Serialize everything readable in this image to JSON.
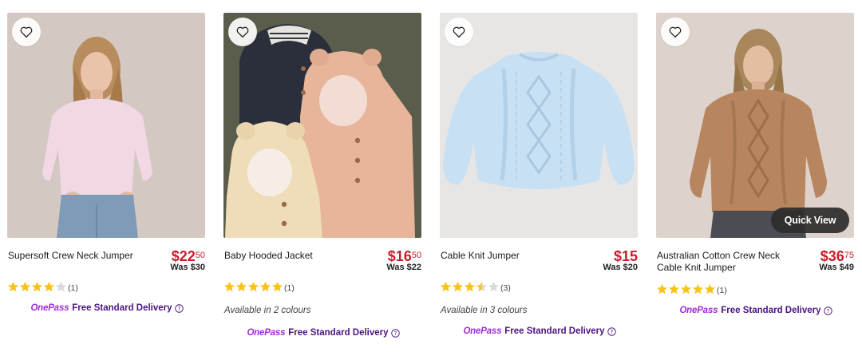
{
  "products": [
    {
      "title": "Supersoft Crew Neck Jumper",
      "price_dollars": "$22",
      "price_cents": "50",
      "was": "Was $30",
      "rating": 4,
      "review_count": "(1)",
      "colours": "",
      "onepass": "OnePass",
      "delivery": "Free Standard Delivery",
      "quick_view": ""
    },
    {
      "title": "Baby Hooded Jacket",
      "price_dollars": "$16",
      "price_cents": "50",
      "was": "Was $22",
      "rating": 5,
      "review_count": "(1)",
      "colours": "Available in 2 colours",
      "onepass": "OnePass",
      "delivery": "Free Standard Delivery",
      "quick_view": ""
    },
    {
      "title": "Cable Knit Jumper",
      "price_dollars": "$15",
      "price_cents": "",
      "was": "Was $20",
      "rating": 3.5,
      "review_count": "(3)",
      "colours": "Available in 3 colours",
      "onepass": "OnePass",
      "delivery": "Free Standard Delivery",
      "quick_view": ""
    },
    {
      "title": "Australian Cotton Crew Neck Cable Knit Jumper",
      "price_dollars": "$36",
      "price_cents": "75",
      "was": "Was $49",
      "rating": 5,
      "review_count": "(1)",
      "colours": "",
      "onepass": "OnePass",
      "delivery": "Free Standard Delivery",
      "quick_view": "Quick View"
    }
  ],
  "colors": {
    "price": "#cc1b2b",
    "star": "#f7c21b",
    "onepass": "#a12bd8",
    "delivery": "#4a1480"
  }
}
